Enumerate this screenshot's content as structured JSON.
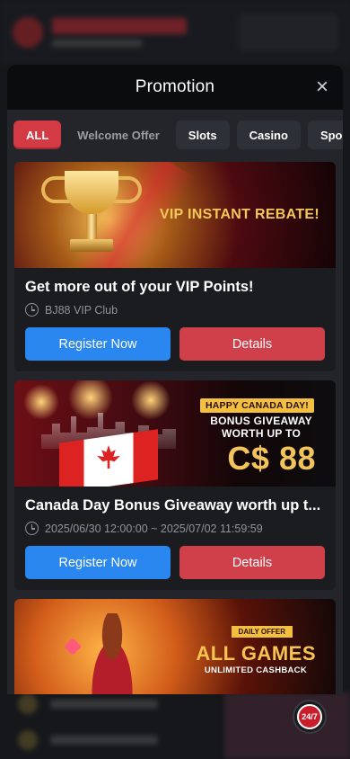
{
  "modal": {
    "title": "Promotion",
    "close_icon": "close-icon"
  },
  "tabs": [
    {
      "label": "ALL",
      "active": true
    },
    {
      "label": "Welcome Offer",
      "active": false
    },
    {
      "label": "Slots",
      "active": false
    },
    {
      "label": "Casino",
      "active": false
    },
    {
      "label": "Spo",
      "active": false
    }
  ],
  "promotions": [
    {
      "banner_text": "VIP INSTANT REBATE!",
      "title": "Get more out of your VIP Points!",
      "meta": "BJ88 VIP Club",
      "register_label": "Register Now",
      "details_label": "Details"
    },
    {
      "banner_badge": "HAPPY CANADA DAY!",
      "banner_line1": "BONUS GIVEAWAY",
      "banner_line2": "WORTH UP TO",
      "banner_amount": "C$ 88",
      "title": "Canada Day Bonus Giveaway worth up t...",
      "meta": "2025/06/30 12:00:00 ~ 2025/07/02 11:59:59",
      "register_label": "Register Now",
      "details_label": "Details"
    },
    {
      "banner_badge": "DAILY OFFER",
      "banner_line1": "ALL GAMES",
      "banner_line2": "UNLIMITED CASHBACK"
    }
  ],
  "support": {
    "label": "24/7"
  },
  "colors": {
    "accent_red": "#cf404b",
    "accent_blue": "#2b87f0",
    "gold": "#f3c75a"
  }
}
